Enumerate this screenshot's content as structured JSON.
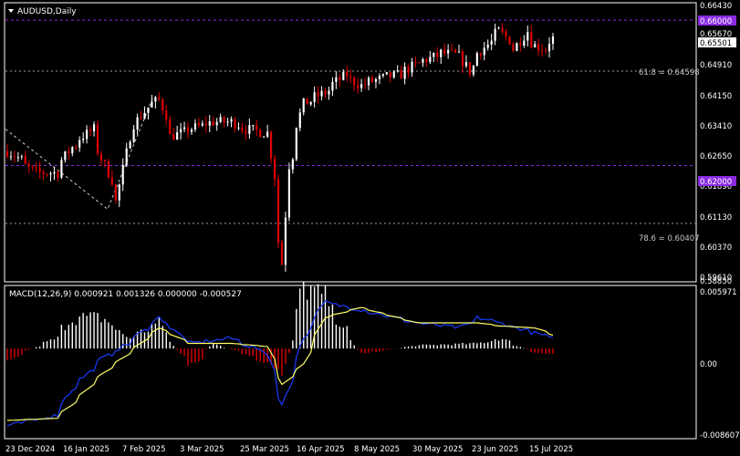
{
  "window": {
    "symbol_title": "AUDUSD,Daily",
    "macd_label": "MACD(12,26,9) 0.000921 0.001326 0.000000 -0.000527"
  },
  "colors": {
    "background": "#000000",
    "frame": "#ffffff",
    "bull": "#ffffff",
    "bear": "#e00000",
    "level_line": "#8a2be2",
    "fib_line": "#a0a0a0",
    "macd_line": "#1a3cff",
    "signal_line": "#ffff66",
    "current_tag": "#ffffff"
  },
  "price_axis": {
    "ticks": [
      "0.66430",
      "0.65670",
      "0.64910",
      "0.64150",
      "0.63410",
      "0.62650",
      "0.61890",
      "0.61130",
      "0.60370",
      "0.59610",
      "0.58850"
    ],
    "current_price": "0.65501",
    "level_tags": [
      "0.66000",
      "0.62000"
    ]
  },
  "macd_axis": {
    "ticks": [
      "0.005971",
      "0.00",
      "-0.008607"
    ]
  },
  "fib_levels": [
    {
      "label": "61.8 = 0.64598",
      "price": 0.64598
    },
    {
      "label": "78.6 = 0.60407",
      "price": 0.60407
    }
  ],
  "horizontal_levels": [
    0.66,
    0.62
  ],
  "time_axis": {
    "labels": [
      "23 Dec 2024",
      "16 Jan 2025",
      "7 Feb 2025",
      "3 Mar 2025",
      "25 Mar 2025",
      "16 Apr 2025",
      "8 May 2025",
      "30 May 2025",
      "23 Jun 2025",
      "15 Jul 2025"
    ]
  },
  "chart_data": [
    {
      "type": "candlestick",
      "title": "AUDUSD,Daily",
      "ylim": [
        0.5885,
        0.6643
      ],
      "anchor_closes": [
        {
          "x": "23 Dec 2024",
          "y": 0.624
        },
        {
          "x": "2 Jan 2025",
          "y": 0.618
        },
        {
          "x": "10 Jan 2025",
          "y": 0.618
        },
        {
          "x": "16 Jan 2025",
          "y": 0.625
        },
        {
          "x": "24 Jan 2025",
          "y": 0.63
        },
        {
          "x": "3 Feb 2025",
          "y": 0.61
        },
        {
          "x": "7 Feb 2025",
          "y": 0.628
        },
        {
          "x": "14 Feb 2025",
          "y": 0.636
        },
        {
          "x": "19 Feb 2025",
          "y": 0.638
        },
        {
          "x": "24 Feb 2025",
          "y": 0.628
        },
        {
          "x": "3 Mar 2025",
          "y": 0.63
        },
        {
          "x": "12 Mar 2025",
          "y": 0.632
        },
        {
          "x": "19 Mar 2025",
          "y": 0.632
        },
        {
          "x": "25 Mar 2025",
          "y": 0.63
        },
        {
          "x": "2 Apr 2025",
          "y": 0.629
        },
        {
          "x": "8 Apr 2025",
          "y": 0.593
        },
        {
          "x": "10 Apr 2025",
          "y": 0.62
        },
        {
          "x": "16 Apr 2025",
          "y": 0.637
        },
        {
          "x": "24 Apr 2025",
          "y": 0.64
        },
        {
          "x": "2 May 2025",
          "y": 0.645
        },
        {
          "x": "8 May 2025",
          "y": 0.642
        },
        {
          "x": "16 May 2025",
          "y": 0.644
        },
        {
          "x": "23 May 2025",
          "y": 0.645
        },
        {
          "x": "30 May 2025",
          "y": 0.648
        },
        {
          "x": "9 Jun 2025",
          "y": 0.651
        },
        {
          "x": "16 Jun 2025",
          "y": 0.65
        },
        {
          "x": "19 Jun 2025",
          "y": 0.646
        },
        {
          "x": "23 Jun 2025",
          "y": 0.651
        },
        {
          "x": "1 Jul 2025",
          "y": 0.657
        },
        {
          "x": "7 Jul 2025",
          "y": 0.652
        },
        {
          "x": "11 Jul 2025",
          "y": 0.657
        },
        {
          "x": "15 Jul 2025",
          "y": 0.653
        },
        {
          "x": "18 Jul 2025",
          "y": 0.652
        },
        {
          "x": "22 Jul 2025",
          "y": 0.655
        }
      ]
    },
    {
      "type": "bar",
      "title": "MACD(12,26,9)",
      "ylim": [
        -0.008607,
        0.005971
      ],
      "values": {
        "main": 0.000921,
        "signal": 0.001326
      },
      "anchor_histogram": [
        {
          "x": "23 Dec 2024",
          "y": -0.001
        },
        {
          "x": "10 Jan 2025",
          "y": 0.001
        },
        {
          "x": "16 Jan 2025",
          "y": 0.003
        },
        {
          "x": "28 Jan 2025",
          "y": 0.003
        },
        {
          "x": "7 Feb 2025",
          "y": 0.001
        },
        {
          "x": "19 Feb 2025",
          "y": 0.0025
        },
        {
          "x": "3 Mar 2025",
          "y": -0.002
        },
        {
          "x": "12 Mar 2025",
          "y": 0.0005
        },
        {
          "x": "25 Mar 2025",
          "y": -0.0006
        },
        {
          "x": "8 Apr 2025",
          "y": -0.0025
        },
        {
          "x": "16 Apr 2025",
          "y": 0.006
        },
        {
          "x": "24 Apr 2025",
          "y": 0.005
        },
        {
          "x": "8 May 2025",
          "y": -0.0005
        },
        {
          "x": "30 May 2025",
          "y": 0.0003
        },
        {
          "x": "23 Jun 2025",
          "y": 0.0005
        },
        {
          "x": "1 Jul 2025",
          "y": 0.001
        },
        {
          "x": "15 Jul 2025",
          "y": -0.0005
        },
        {
          "x": "22 Jul 2025",
          "y": -0.0005
        }
      ],
      "anchor_main": [
        {
          "x": "23 Dec 2024",
          "y": -0.0075
        },
        {
          "x": "10 Jan 2025",
          "y": -0.0065
        },
        {
          "x": "16 Jan 2025",
          "y": -0.004
        },
        {
          "x": "28 Jan 2025",
          "y": -0.001
        },
        {
          "x": "7 Feb 2025",
          "y": 0.0005
        },
        {
          "x": "19 Feb 2025",
          "y": 0.003
        },
        {
          "x": "3 Mar 2025",
          "y": 0.0005
        },
        {
          "x": "19 Mar 2025",
          "y": 0.001
        },
        {
          "x": "2 Apr 2025",
          "y": -0.0005
        },
        {
          "x": "8 Apr 2025",
          "y": -0.0055
        },
        {
          "x": "16 Apr 2025",
          "y": 0.001
        },
        {
          "x": "24 Apr 2025",
          "y": 0.0045
        },
        {
          "x": "8 May 2025",
          "y": 0.0038
        },
        {
          "x": "30 May 2025",
          "y": 0.0025
        },
        {
          "x": "16 Jun 2025",
          "y": 0.002
        },
        {
          "x": "23 Jun 2025",
          "y": 0.003
        },
        {
          "x": "1 Jul 2025",
          "y": 0.0025
        },
        {
          "x": "15 Jul 2025",
          "y": 0.0015
        },
        {
          "x": "22 Jul 2025",
          "y": 0.0009
        }
      ],
      "anchor_signal": [
        {
          "x": "23 Dec 2024",
          "y": -0.007
        },
        {
          "x": "10 Jan 2025",
          "y": -0.0068
        },
        {
          "x": "16 Jan 2025",
          "y": -0.0055
        },
        {
          "x": "28 Jan 2025",
          "y": -0.0025
        },
        {
          "x": "7 Feb 2025",
          "y": -0.0005
        },
        {
          "x": "19 Feb 2025",
          "y": 0.002
        },
        {
          "x": "3 Mar 2025",
          "y": 0.0005
        },
        {
          "x": "19 Mar 2025",
          "y": 0.0005
        },
        {
          "x": "2 Apr 2025",
          "y": 0.0002
        },
        {
          "x": "8 Apr 2025",
          "y": -0.0035
        },
        {
          "x": "16 Apr 2025",
          "y": -0.0015
        },
        {
          "x": "24 Apr 2025",
          "y": 0.003
        },
        {
          "x": "8 May 2025",
          "y": 0.004
        },
        {
          "x": "30 May 2025",
          "y": 0.0025
        },
        {
          "x": "16 Jun 2025",
          "y": 0.0025
        },
        {
          "x": "23 Jun 2025",
          "y": 0.0025
        },
        {
          "x": "1 Jul 2025",
          "y": 0.0022
        },
        {
          "x": "15 Jul 2025",
          "y": 0.002
        },
        {
          "x": "22 Jul 2025",
          "y": 0.0013
        }
      ]
    }
  ]
}
